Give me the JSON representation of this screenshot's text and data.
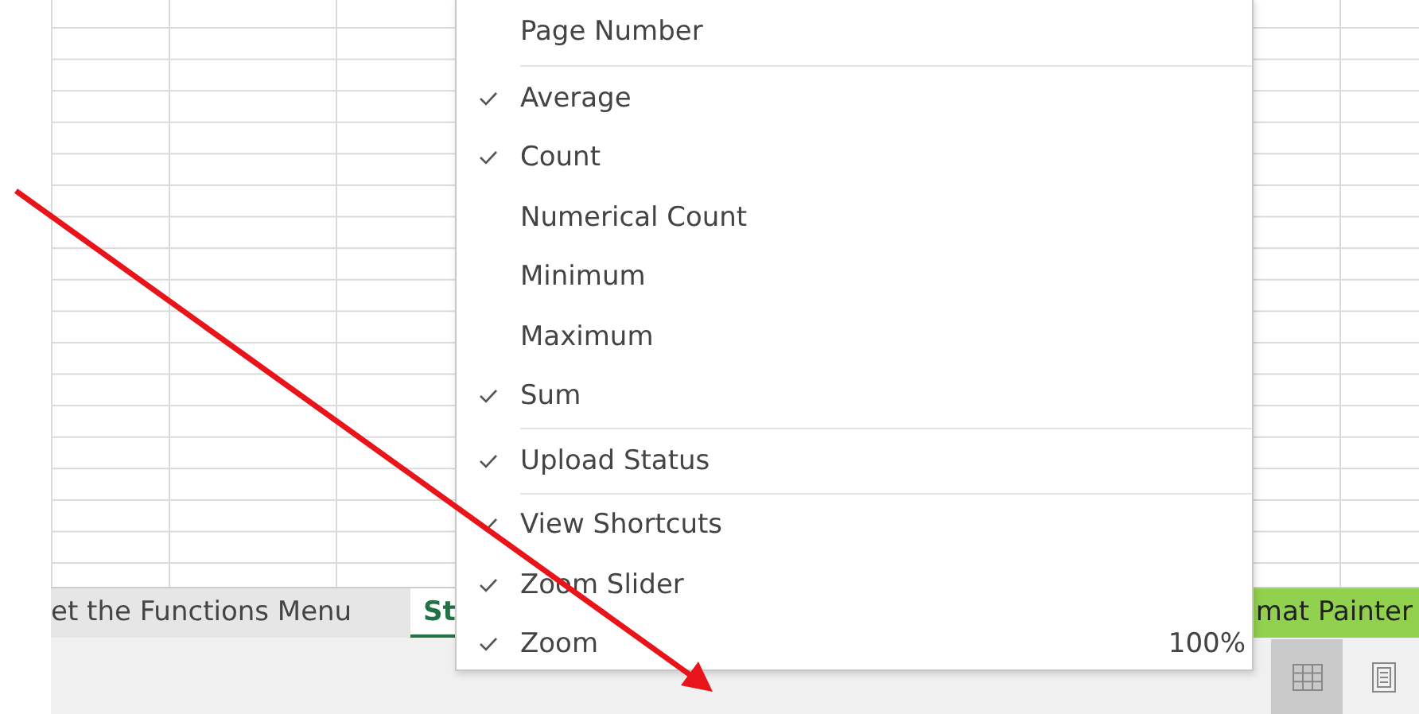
{
  "sheet_tabs": [
    {
      "label": "et the Functions Menu",
      "selected": false,
      "color": "#e6e6e6"
    },
    {
      "label": "St",
      "selected": true,
      "color": "#ffffff"
    },
    {
      "label": "mat Painter",
      "selected": false,
      "color": "#92d050"
    }
  ],
  "view_buttons": [
    {
      "kind": "normal",
      "selected": true
    },
    {
      "kind": "page_layout",
      "selected": false
    }
  ],
  "context_menu": {
    "items": [
      {
        "label": "Page Number",
        "checked": false,
        "divider_below": true
      },
      {
        "label": "Average",
        "checked": true,
        "divider_below": false
      },
      {
        "label": "Count",
        "checked": true,
        "divider_below": false
      },
      {
        "label": "Numerical Count",
        "checked": false,
        "divider_below": false
      },
      {
        "label": "Minimum",
        "checked": false,
        "divider_below": false
      },
      {
        "label": "Maximum",
        "checked": false,
        "divider_below": false
      },
      {
        "label": "Sum",
        "checked": true,
        "divider_below": true
      },
      {
        "label": "Upload Status",
        "checked": true,
        "divider_below": true
      },
      {
        "label": "View Shortcuts",
        "checked": true,
        "divider_below": false
      },
      {
        "label": "Zoom Slider",
        "checked": true,
        "divider_below": false
      },
      {
        "label": "Zoom",
        "checked": true,
        "divider_below": false,
        "value": "100%"
      }
    ]
  }
}
